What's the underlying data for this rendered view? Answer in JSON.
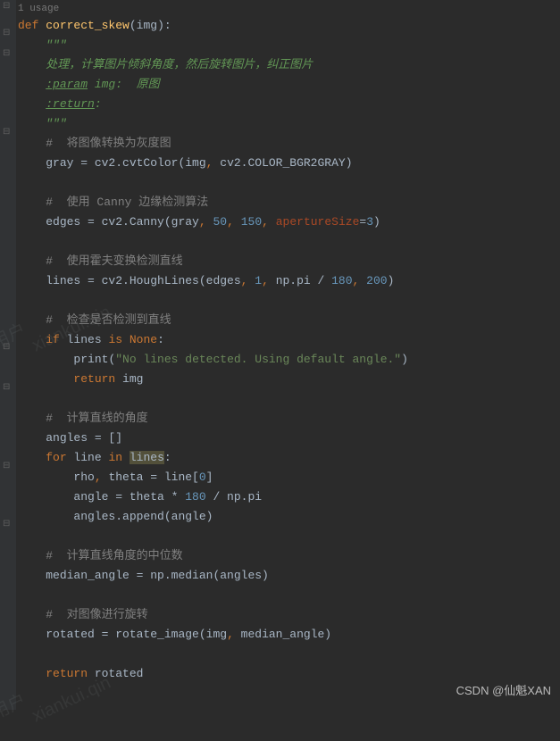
{
  "usage": "1 usage",
  "code": {
    "def": "def",
    "fn_name": "correct_skew",
    "param": "img",
    "doc1": "\"\"\"",
    "doc_desc": "处理，计算图片倾斜角度，然后旋转图片，纠正图片",
    "doc_param_tag": ":param",
    "doc_param_rest": " img:  原图",
    "doc_return_tag": ":return",
    "doc_return_rest": ":",
    "doc2": "\"\"\"",
    "c1": "#  将图像转换为灰度图",
    "l1a": "gray = cv2.cvtColor(img",
    "l1b": " cv2.COLOR_BGR2GRAY)",
    "c2": "#  使用 Canny 边缘检测算法",
    "l2a": "edges = cv2.Canny(gray",
    "n50": "50",
    "n150": "150",
    "kwarg1": "apertureSize",
    "n3": "3",
    "c3": "#  使用霍夫变换检测直线",
    "l3a": "lines = cv2.HoughLines(edges",
    "n1": "1",
    "l3b": " np.pi / ",
    "n180": "180",
    "n200": "200",
    "c4": "#  检查是否检测到直线",
    "if": "if",
    "l4a": " lines ",
    "is": "is",
    "none": " None",
    "print": "print",
    "str1": "\"No lines detected. Using default angle.\"",
    "return": "return",
    "l5": " img",
    "c5": "#  计算直线的角度",
    "l6": "angles = []",
    "for": "for",
    "l7a": " line ",
    "in": "in",
    "l7b": " ",
    "lines_hl": "lines",
    "l8a": "rho",
    "l8b": " theta = line[",
    "n0": "0",
    "l8c": "]",
    "l9a": "angle = theta * ",
    "l9b": " / np.pi",
    "l10": "angles.append(angle)",
    "c6": "#  计算直线角度的中位数",
    "l11": "median_angle = np.median(angles)",
    "c7": "#  对图像进行旋转",
    "l12a": "rotated = rotate_image(img",
    "l12b": " median_angle)",
    "l13": " rotated"
  },
  "watermark1": "用户",
  "watermark2": "xiankui.qin",
  "credit": "CSDN @仙魁XAN"
}
